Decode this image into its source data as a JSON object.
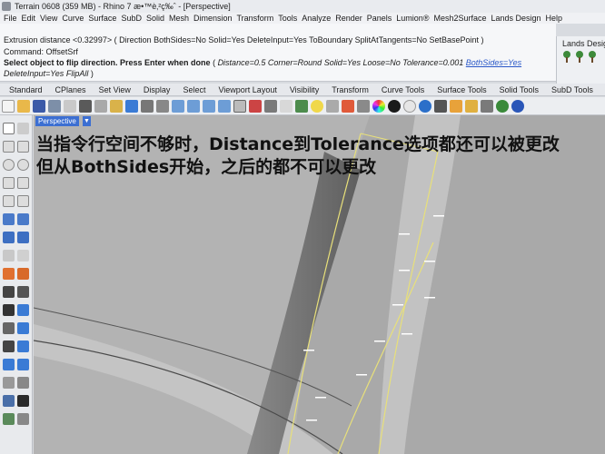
{
  "window": {
    "title": "Terrain 0608 (359 MB) - Rhino 7 æ•™è‚²ç‰ˆ - [Perspective]"
  },
  "menu": {
    "items": [
      "File",
      "Edit",
      "View",
      "Curve",
      "Surface",
      "SubD",
      "Solid",
      "Mesh",
      "Dimension",
      "Transform",
      "Tools",
      "Analyze",
      "Render",
      "Panels",
      "Lumion®",
      "Mesh2Surface",
      "Lands Design",
      "Help"
    ]
  },
  "command_history": {
    "line1": "Extrusion distance <0.32997> ( Direction  BothSides=No  Solid=Yes  DeleteInput=Yes  ToBoundary  SplitAtTangents=No  SetBasePoint )",
    "line2": "Command: OffsetSrf",
    "line3": "Select object to flip direction. Press Enter when done",
    "prompt_open": "( ",
    "opt_distance": "Distance=0.5",
    "opt_corner": "Corner=Round",
    "opt_solid": "Solid=Yes",
    "opt_loose": "Loose=No",
    "opt_tolerance": "Tolerance=0.001",
    "opt_bothsides": "BothSides=Yes",
    "line4_opt_deleteinput": "DeleteInput=Yes",
    "line4_opt_flipall": "FlipAll",
    "line4_close": " )"
  },
  "lands_panel": {
    "title": "Lands Design"
  },
  "toolbar_tabs": [
    "Standard",
    "CPlanes",
    "Set View",
    "Display",
    "Select",
    "Viewport Layout",
    "Visibility",
    "Transform",
    "Curve Tools",
    "Surface Tools",
    "Solid Tools",
    "SubD Tools"
  ],
  "viewport": {
    "label": "Perspective",
    "dropdown": "▼"
  },
  "annotation": {
    "line1": "当指令行空间不够时，Distance到Tolerance选项都还可以被更改",
    "line2": "但从BothSides开始，之后的都不可以更改"
  }
}
